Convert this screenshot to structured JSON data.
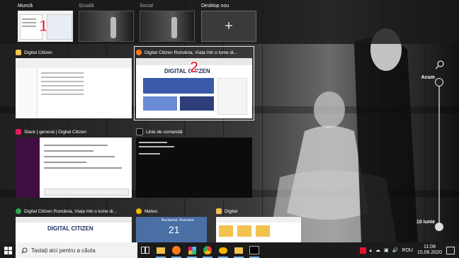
{
  "desktops": [
    {
      "label": "Muncă",
      "active": true,
      "badge": "1"
    },
    {
      "label": "Școală",
      "active": false
    },
    {
      "label": "Social",
      "active": false
    },
    {
      "label": "Desktop nou",
      "icon": "plus-icon",
      "new": true
    }
  ],
  "windows": [
    {
      "title": "Digital Citizen",
      "icon": "file-explorer-icon",
      "icon_color": "#f2c14e"
    },
    {
      "title": "Digital Citizen România, Viața într-o lume di...",
      "icon": "firefox-icon",
      "icon_color": "#ff7a18",
      "selected": true,
      "badge": "2",
      "thumb_logo": "DIGITAL CITIZEN"
    },
    {
      "title": "Slack | general | Digital Citizen",
      "icon": "slack-icon",
      "icon_color": "#e01e5a"
    },
    {
      "title": "Linie de comandă",
      "icon": "cmd-icon",
      "icon_color": "#111111"
    },
    {
      "title": "Digital Citizen România, Viața într-o lume di...",
      "icon": "chrome-icon",
      "icon_color": "#34a853",
      "thumb_logo": "DIGITAL CITIZEN"
    },
    {
      "title": "Meteo",
      "icon": "weather-icon",
      "icon_color": "#f4b400",
      "thumb_city": "Bucharest, Romania",
      "thumb_temp": "21"
    },
    {
      "title": "Digital",
      "icon": "folder-icon",
      "icon_color": "#f2c14e"
    }
  ],
  "timeline": {
    "now_label": "Acum",
    "date_label": "10 iunie"
  },
  "taskbar": {
    "search_placeholder": "Tastați aici pentru a căuta",
    "pinned": [
      "task-view-icon",
      "file-explorer-icon",
      "firefox-icon",
      "slack-icon",
      "chrome-icon",
      "weather-icon",
      "folder-icon",
      "cmd-icon"
    ],
    "language": "ROU",
    "time": "11:08",
    "date": "15.06.2020"
  },
  "colors": {
    "accent": "#7ab4f5",
    "badge": "#e8102a",
    "taskbar": "#1b1b1b"
  }
}
